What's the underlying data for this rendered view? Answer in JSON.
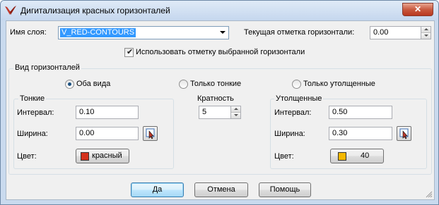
{
  "window": {
    "title": "Дигитализация красных горизонталей",
    "close_label": "✕"
  },
  "layer": {
    "label": "Имя слоя:",
    "value": "V_RED-CONTOURS"
  },
  "current_elevation": {
    "label": "Текущая отметка горизонтали:",
    "value": "0.00"
  },
  "use_selected": {
    "label": "Использовать отметку выбранной горизонтали",
    "checked": true
  },
  "view_group": {
    "title": "Вид горизонталей",
    "options": [
      {
        "label": "Оба вида",
        "selected": true
      },
      {
        "label": "Только тонкие",
        "selected": false
      },
      {
        "label": "Только утолщенные",
        "selected": false
      }
    ]
  },
  "thin": {
    "title": "Тонкие",
    "interval_label": "Интервал:",
    "interval_value": "0.10",
    "width_label": "Ширина:",
    "width_value": "0.00",
    "color_label": "Цвет:",
    "color_name": "красный",
    "color_hex": "#d4321c"
  },
  "multiplicity": {
    "label": "Кратность",
    "value": "5"
  },
  "thick": {
    "title": "Утолщенные",
    "interval_label": "Интервал:",
    "interval_value": "0.50",
    "width_label": "Ширина:",
    "width_value": "0.30",
    "color_label": "Цвет:",
    "color_name": "40",
    "color_hex": "#f5b800"
  },
  "buttons": {
    "ok": "Да",
    "cancel": "Отмена",
    "help": "Помощь"
  },
  "colors": {
    "accent": "#3399ff",
    "close": "#c95a40"
  }
}
